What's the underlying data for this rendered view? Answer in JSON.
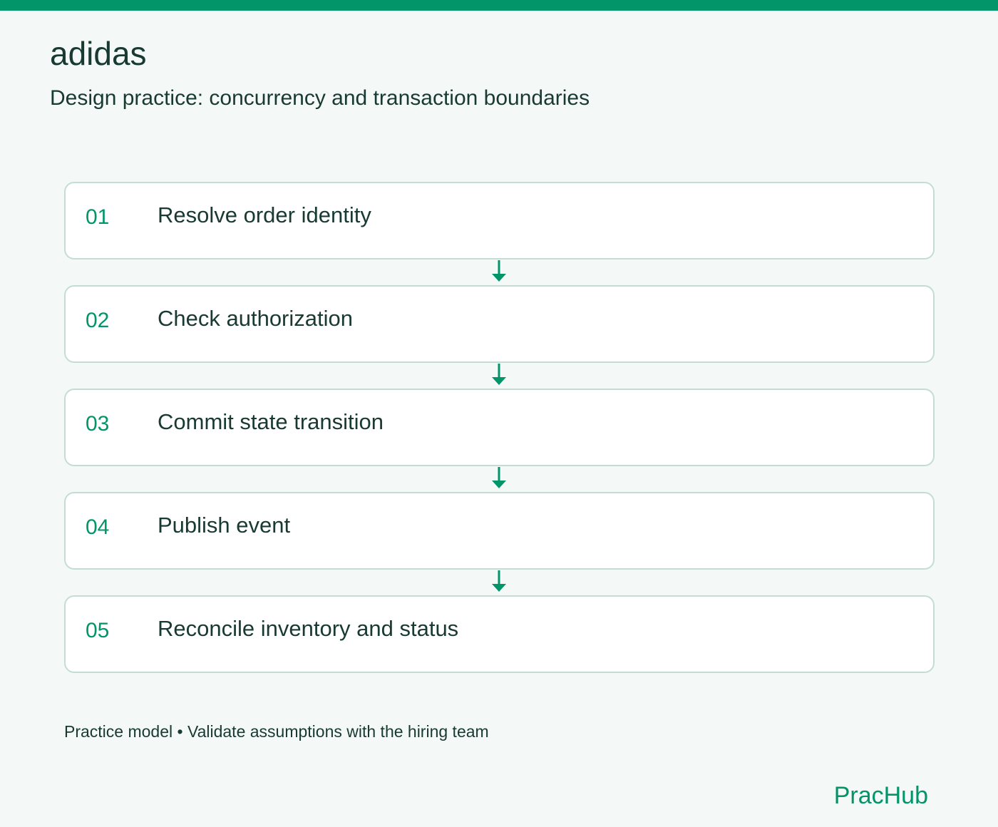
{
  "header": {
    "title": "adidas",
    "subtitle": "Design practice: concurrency and transaction boundaries"
  },
  "steps": [
    {
      "number": "01",
      "label": "Resolve order identity"
    },
    {
      "number": "02",
      "label": "Check authorization"
    },
    {
      "number": "03",
      "label": "Commit state transition"
    },
    {
      "number": "04",
      "label": "Publish event"
    },
    {
      "number": "05",
      "label": "Reconcile inventory and status"
    }
  ],
  "footer": {
    "note": "Practice model • Validate assumptions with the hiring team",
    "logo": "PracHub"
  },
  "colors": {
    "accent": "#03956a",
    "text": "#183a32",
    "card_border": "#c4ddd4",
    "background": "#f4f8f6"
  },
  "icons": {
    "connector": "arrow-down-icon"
  }
}
